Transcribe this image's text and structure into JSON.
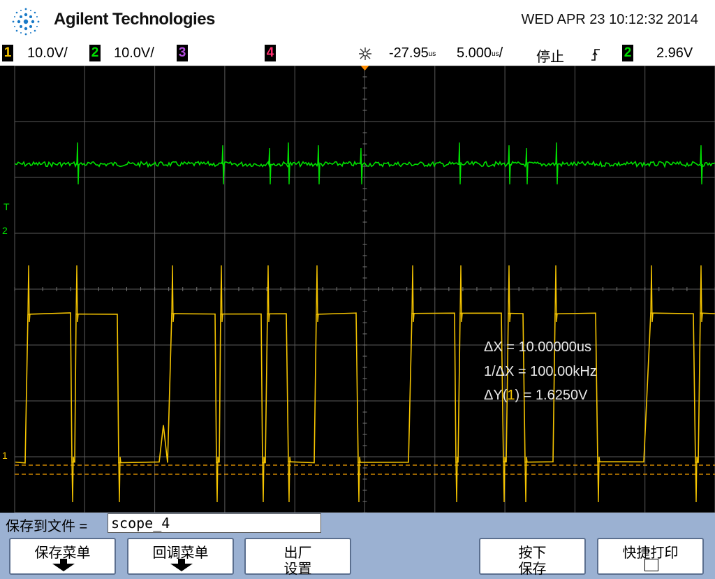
{
  "header": {
    "brand": "Agilent Technologies",
    "datetime": "WED APR 23 10:12:32 2014"
  },
  "status": {
    "ch1": {
      "num": "1",
      "scale": "10.0V/",
      "color": "#f5c400"
    },
    "ch2": {
      "num": "2",
      "scale": "10.0V/",
      "color": "#00e000"
    },
    "ch3": {
      "num": "3",
      "color": "#b04bdc"
    },
    "ch4": {
      "num": "4",
      "color": "#ff2d6e"
    },
    "time_delay": "-27.95",
    "delay_unit": "us",
    "time_scale": "5.000",
    "scale_unit": "us",
    "run_state": "停止",
    "trigger_source": "2",
    "trigger_level": "2.96V"
  },
  "screen": {
    "marker_T": "T",
    "marker_ch2": "2",
    "marker_ch1": "1",
    "measurements": {
      "dx": "ΔX = 10.00000us",
      "inv_dx": "1/ΔX = 100.00kHz",
      "dy_prefix": "ΔY(",
      "dy_channel": "1",
      "dy_suffix": ") = 1.6250V"
    }
  },
  "file": {
    "label": "保存到文件 =",
    "name": "scope_4"
  },
  "softkeys": [
    {
      "line1": "保存菜单",
      "line2": "",
      "icon": "arrow-down"
    },
    {
      "line1": "回调菜单",
      "line2": "",
      "icon": "arrow-down"
    },
    {
      "line1": "出厂",
      "line2": "设置",
      "icon": ""
    },
    {
      "line1": "按下",
      "line2": "保存",
      "icon": ""
    },
    {
      "line1": "快捷打印",
      "line2": "",
      "icon": "checkbox"
    }
  ]
}
